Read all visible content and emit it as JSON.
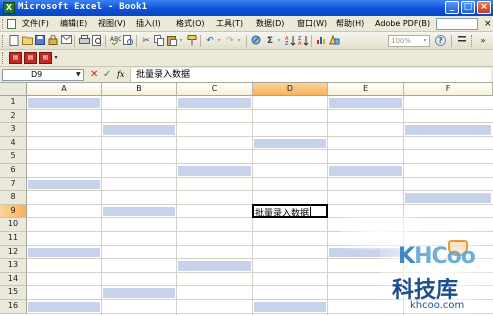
{
  "window": {
    "title": "Microsoft Excel - Book1",
    "app_icon_glyph": "X",
    "min_glyph": "_",
    "max_glyph": "□",
    "close_glyph": "×"
  },
  "menubar": {
    "items": [
      "文件(F)",
      "编辑(E)",
      "视图(V)",
      "插入(I)",
      "格式(O)",
      "工具(T)",
      "数据(D)",
      "窗口(W)",
      "帮助(H)",
      "Adobe PDF(B)"
    ],
    "help_placeholder": "",
    "close_glyph": "×"
  },
  "toolbar": {
    "zoom": "100%",
    "icons": [
      "new-icon",
      "open-icon",
      "save-icon",
      "permission-icon",
      "email-icon",
      "print-icon",
      "print-preview-icon",
      "spelling-icon",
      "research-icon",
      "cut-icon",
      "copy-icon",
      "paste-icon",
      "format-painter-icon",
      "undo-icon",
      "redo-icon",
      "hyperlink-icon",
      "autosum-icon",
      "sort-ascending-icon",
      "sort-descending-icon",
      "chart-wizard-icon",
      "drawing-icon",
      "help-icon"
    ],
    "glyphs": {
      "cut": "✂",
      "undo": "↶",
      "redo": "↷",
      "autosum": "Σ",
      "help": "?"
    }
  },
  "pdf_toolbar": {
    "icons": [
      "convert-to-pdf-icon",
      "convert-and-email-pdf-icon",
      "convert-and-review-pdf-icon"
    ]
  },
  "formula_bar": {
    "name_box": "D9",
    "cancel_glyph": "✕",
    "enter_glyph": "✓",
    "fx_label": "fx",
    "formula": "批量录入数据"
  },
  "sheet": {
    "columns": [
      "A",
      "B",
      "C",
      "D",
      "E",
      "F"
    ],
    "active_column": "D",
    "rows": [
      "1",
      "2",
      "3",
      "4",
      "5",
      "6",
      "7",
      "8",
      "9",
      "10",
      "11",
      "12",
      "13",
      "14",
      "15",
      "16"
    ],
    "active_row": "9",
    "active_cell": "D9",
    "active_cell_value": "批量录入数据",
    "selection_color": "#c6d3ea",
    "highlighted_cells": [
      "A1",
      "C1",
      "E1",
      "B3",
      "F3",
      "D4",
      "C6",
      "E6",
      "A7",
      "F8",
      "B9",
      "A12",
      "E12",
      "C13",
      "B15",
      "A16",
      "D16"
    ]
  },
  "watermark": {
    "logo": "KHCoo",
    "logo_initial": "K",
    "logo_rest": "HCoo",
    "name": "科技库",
    "url": "khcoo.com"
  }
}
